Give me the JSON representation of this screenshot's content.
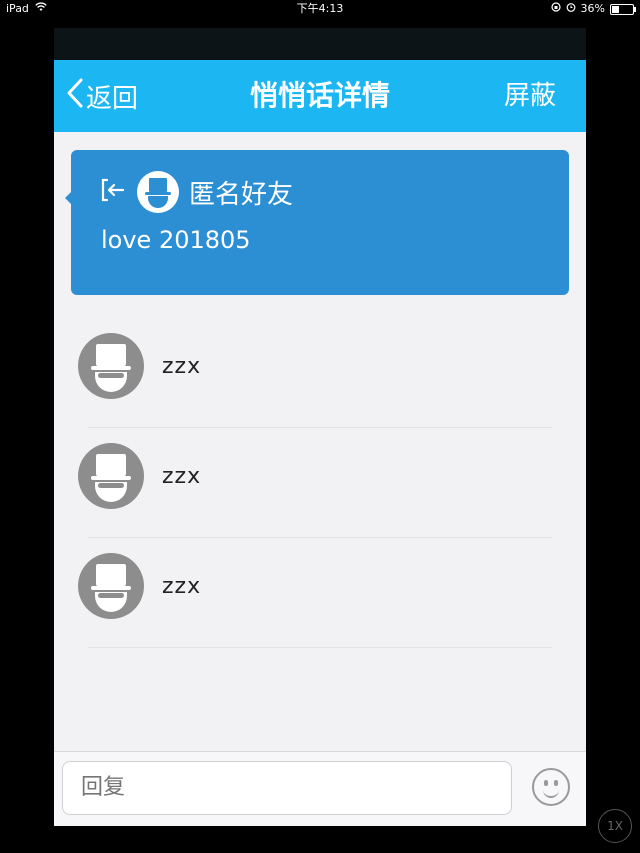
{
  "status_bar": {
    "device": "iPad",
    "time": "下午4:13",
    "battery": "36%"
  },
  "nav": {
    "back_label": "返回",
    "title": "悄悄话详情",
    "right_label": "屏蔽"
  },
  "card": {
    "name": "匿名好友",
    "message": "love 201805"
  },
  "list": {
    "items": [
      {
        "name": "zzx"
      },
      {
        "name": "zzx"
      },
      {
        "name": "zzx"
      }
    ]
  },
  "reply": {
    "placeholder": "回复"
  },
  "zoom": {
    "label": "1X"
  },
  "colors": {
    "nav_blue": "#1cb7f3",
    "card_blue": "#2d8fd3"
  }
}
